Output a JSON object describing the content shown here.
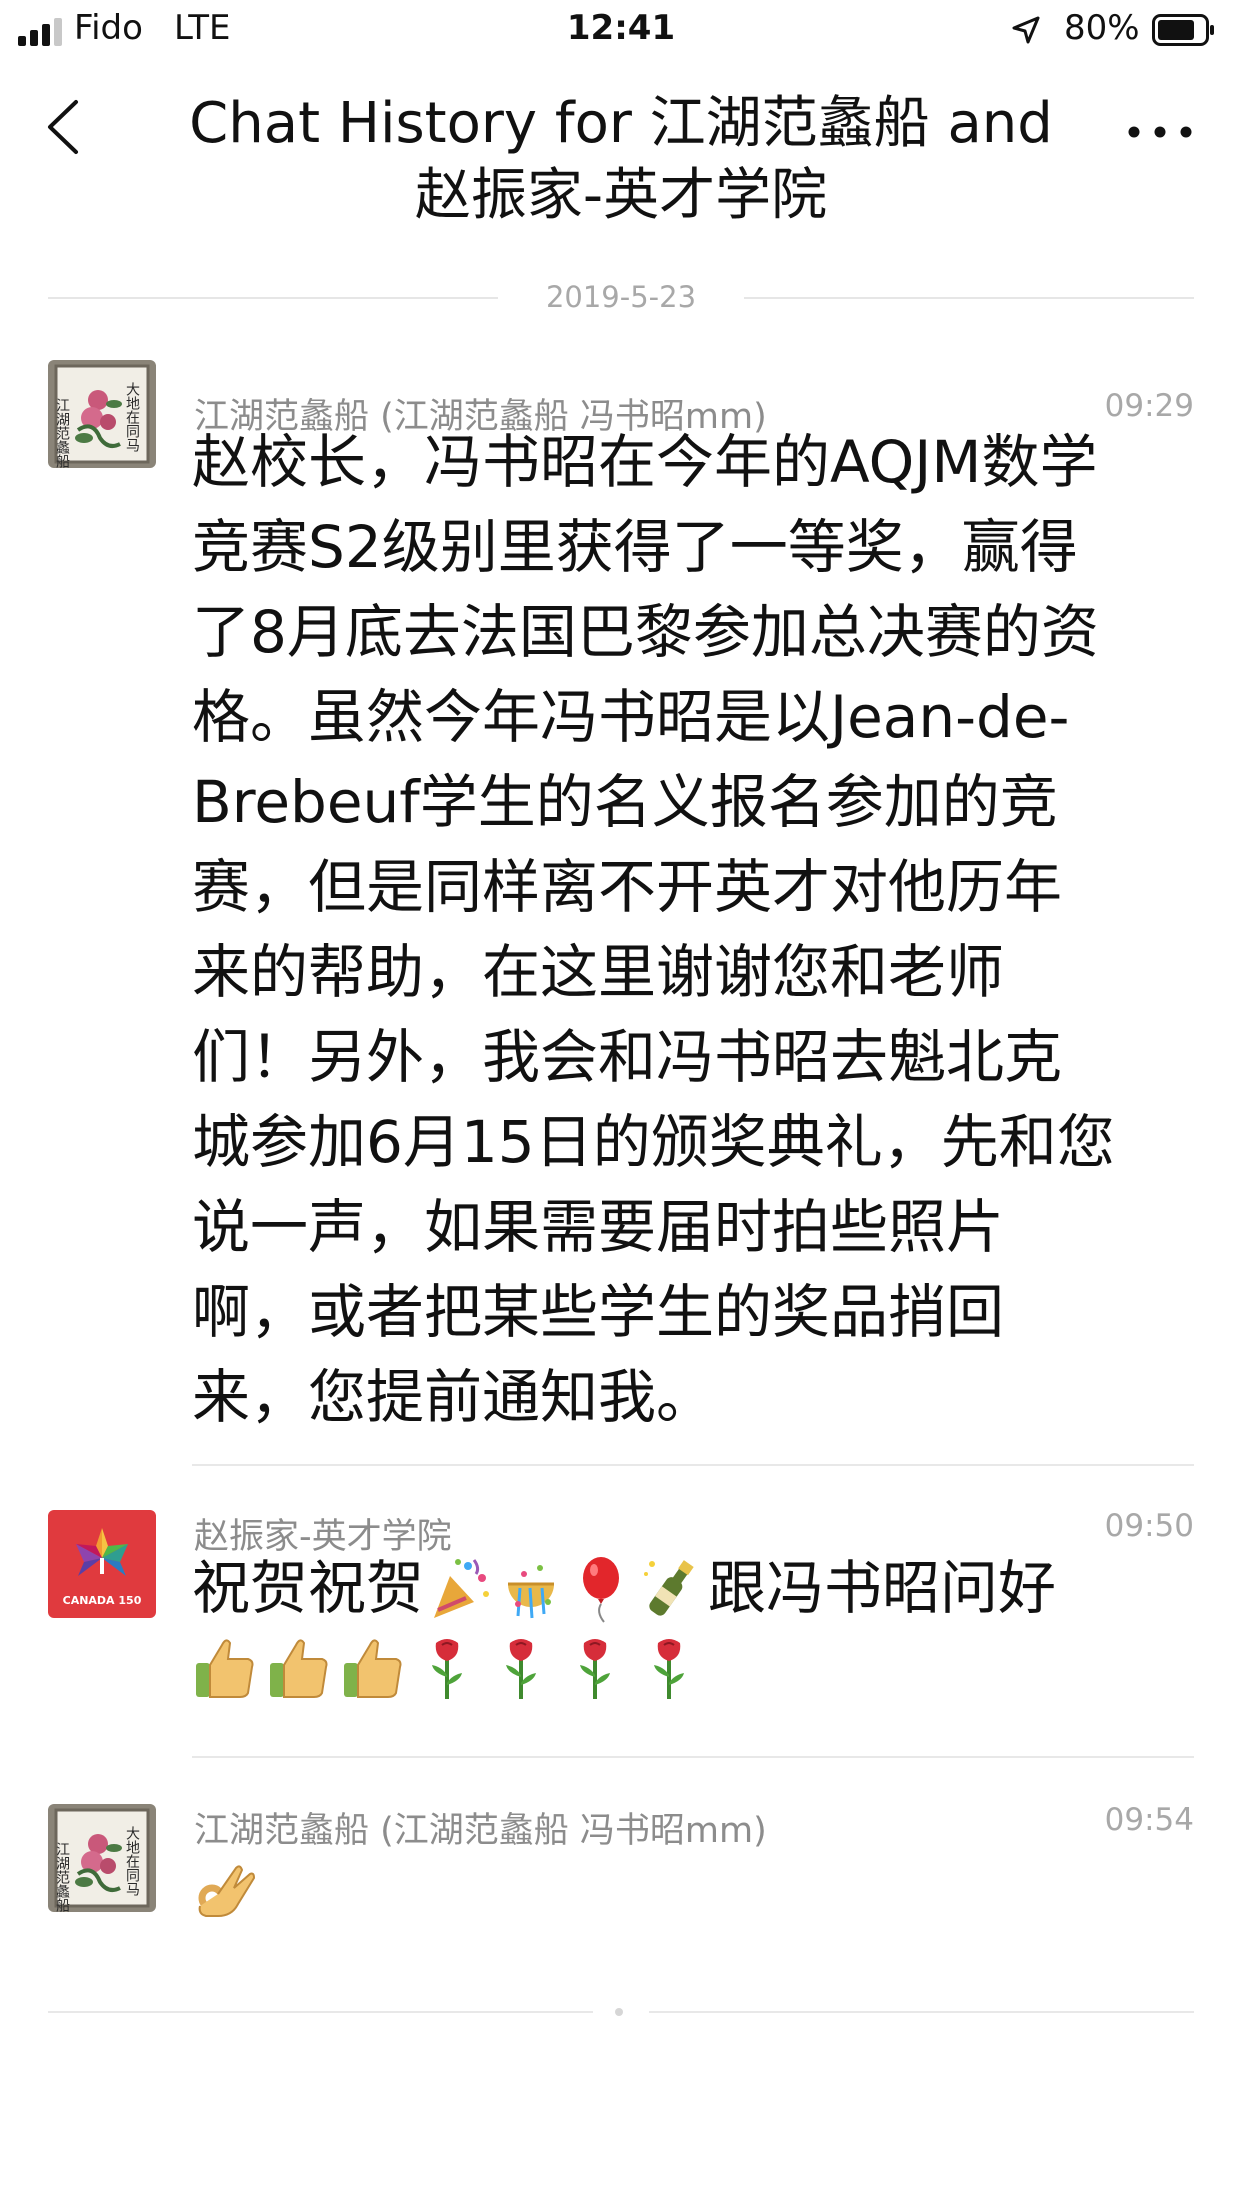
{
  "status_bar": {
    "carrier": "Fido",
    "network": "LTE",
    "time": "12:41",
    "battery": "80%",
    "battery_level": 0.8
  },
  "nav": {
    "title_line1": "Chat History for 江湖范蠡船 and",
    "title_line2": "赵振家-英才学院",
    "back_icon": "chevron-left-icon",
    "more_icon": "more-dots-icon"
  },
  "date_divider": "2019-5-23",
  "messages": [
    {
      "sender": "江湖范蠡船 (江湖范蠡船 冯书昭mm)",
      "time": "09:29",
      "avatar": "calligraphy-flower-painting",
      "lines": [
        "赵校长，冯书昭在今年的AQJM数学",
        "竞赛S2级别里获得了一等奖，赢得",
        "了8月底去法国巴黎参加总决赛的资",
        "格。虽然今年冯书昭是以Jean-de-",
        "Brebeuf学生的名义报名参加的竞",
        "赛，但是同样离不开英才对他历年",
        "来的帮助，在这里谢谢您和老师",
        "们！另外，我会和冯书昭去魁北克",
        "城参加6月15日的颁奖典礼，先和您",
        "说一声，如果需要届时拍些照片",
        "啊，或者把某些学生的奖品捎回",
        "来，您提前通知我。"
      ]
    },
    {
      "sender": "赵振家-英才学院",
      "time": "09:50",
      "avatar": "canada-150-logo",
      "avatar_caption": "CANADA 150",
      "text_start": "祝贺祝贺",
      "text_end": "跟冯书昭问好",
      "emojis_inline": [
        "party-popper",
        "confetti-ball",
        "balloon",
        "champagne"
      ],
      "emojis_row2": [
        "thumbs-up",
        "thumbs-up",
        "thumbs-up",
        "rose",
        "rose",
        "rose",
        "rose"
      ]
    },
    {
      "sender": "江湖范蠡船 (江湖范蠡船 冯书昭mm)",
      "time": "09:54",
      "avatar": "calligraphy-flower-painting",
      "emojis": [
        "ok-hand"
      ]
    }
  ],
  "colors": {
    "meta_gray": "#8c8c8c",
    "time_gray": "#a8a8a8",
    "divider": "#e8e8e8",
    "canada_red": "#e03a3e"
  }
}
